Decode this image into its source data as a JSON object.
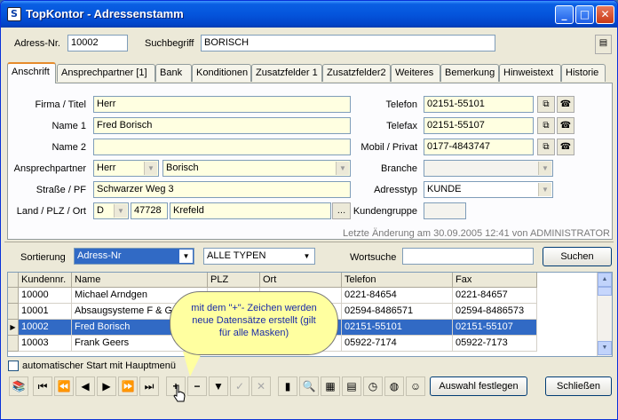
{
  "window": {
    "title": "TopKontor - Adressenstamm",
    "icon": "app-icon"
  },
  "header": {
    "adress_nr_label": "Adress-Nr.",
    "adress_nr_value": "10002",
    "suchbegriff_label": "Suchbegriff",
    "suchbegriff_value": "BORISCH"
  },
  "tabs": [
    {
      "label": "Anschrift"
    },
    {
      "label": "Ansprechpartner [1]"
    },
    {
      "label": "Bank"
    },
    {
      "label": "Konditionen"
    },
    {
      "label": "Zusatzfelder 1"
    },
    {
      "label": "Zusatzfelder2"
    },
    {
      "label": "Weiteres"
    },
    {
      "label": "Bemerkung"
    },
    {
      "label": "Hinweistext"
    },
    {
      "label": "Historie"
    }
  ],
  "form": {
    "firma_label": "Firma / Titel",
    "firma_value": "Herr",
    "name1_label": "Name 1",
    "name1_value": "Fred Borisch",
    "name2_label": "Name 2",
    "name2_value": "",
    "ansprech_label": "Ansprechpartner",
    "ansprech_anrede": "Herr",
    "ansprech_name": "Borisch",
    "strasse_label": "Straße / PF",
    "strasse_value": "Schwarzer Weg 3",
    "land_label": "Land / PLZ / Ort",
    "land_value": "D",
    "plz_value": "47728",
    "ort_value": "Krefeld",
    "telefon_label": "Telefon",
    "telefon_value": "02151-55101",
    "telefax_label": "Telefax",
    "telefax_value": "02151-55107",
    "mobil_label": "Mobil / Privat",
    "mobil_value": "0177-4843747",
    "branche_label": "Branche",
    "branche_value": "",
    "adresstyp_label": "Adresstyp",
    "adresstyp_value": "KUNDE",
    "kundengruppe_label": "Kundengruppe",
    "kundengruppe_value": "",
    "last_change": "Letzte Änderung am  30.09.2005 12:41 von ADMINISTRATOR"
  },
  "search": {
    "sortierung_label": "Sortierung",
    "sortierung_value": "Adress-Nr",
    "typ_value": "ALLE TYPEN",
    "wortsuche_label": "Wortsuche",
    "wortsuche_value": "",
    "suchen_label": "Suchen"
  },
  "grid": {
    "columns": [
      "Kundennr.",
      "Name",
      "PLZ",
      "Ort",
      "Telefon",
      "Fax"
    ],
    "rows": [
      [
        "10000",
        "Michael Arndgen",
        "",
        "",
        "0221-84654",
        "0221-84657"
      ],
      [
        "10001",
        "Absaugsysteme F & G G",
        "",
        "",
        "02594-8486571",
        "02594-8486573"
      ],
      [
        "10002",
        "Fred Borisch",
        "",
        "",
        "02151-55101",
        "02151-55107"
      ],
      [
        "10003",
        "Frank Geers",
        "",
        "",
        "05922-7174",
        "05922-7173"
      ]
    ]
  },
  "tooltip": {
    "text": "mit dem \"+\"- Zeichen werden neue Datensätze erstellt (gilt für alle Masken)"
  },
  "footer": {
    "autostart_label": "automatischer Start mit Hauptmenü",
    "auswahl_label": "Auswahl festlegen",
    "schliessen_label": "Schließen"
  }
}
